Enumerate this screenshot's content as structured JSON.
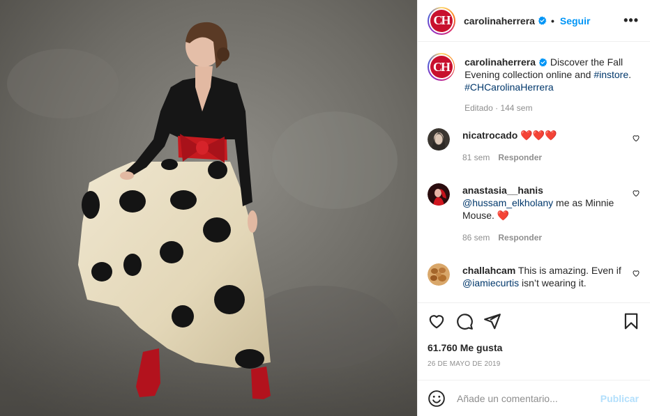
{
  "header": {
    "avatar_letters": "CH",
    "username": "carolinaherrera",
    "separator": "•",
    "follow_label": "Seguir",
    "more_label": "•••"
  },
  "caption": {
    "username": "carolinaherrera",
    "text_before": " Discover the Fall Evening collection online and ",
    "hashtag_1": "#instore",
    "text_after": ".",
    "hashtag_2": "#CHCarolinaHerrera",
    "edited": "Editado",
    "meta_sep": " · ",
    "age": "144 sem"
  },
  "comments": [
    {
      "username": "nicatrocado",
      "text": " ❤️❤️❤️",
      "age": "81 sem",
      "reply_label": "Responder"
    },
    {
      "username": "anastasia__hanis",
      "mention": "@hussam_elkholany",
      "text": " me as Minnie Mouse. ❤️",
      "age": "86 sem",
      "reply_label": "Responder"
    },
    {
      "username": "challahcam",
      "text_before": " This is amazing. Even if ",
      "mention": "@iamiecurtis",
      "text_after": " isn’t wearing it."
    }
  ],
  "stats": {
    "likes": "61.760 Me gusta",
    "date": "26 DE MAYO DE 2019"
  },
  "add_comment": {
    "placeholder": "Añade un comentario...",
    "post_label": "Publicar"
  },
  "colors": {
    "brand_red": "#c8102e",
    "link_blue": "#0095f6",
    "hashtag_blue": "#00376b",
    "muted_gray": "#8e8e8e",
    "disabled_blue": "#b2dffc"
  },
  "icons": {
    "verified": "verified-badge-icon",
    "like": "heart-icon",
    "comment": "comment-bubble-icon",
    "share": "paper-plane-icon",
    "save": "bookmark-icon",
    "emoji": "smiley-icon"
  }
}
